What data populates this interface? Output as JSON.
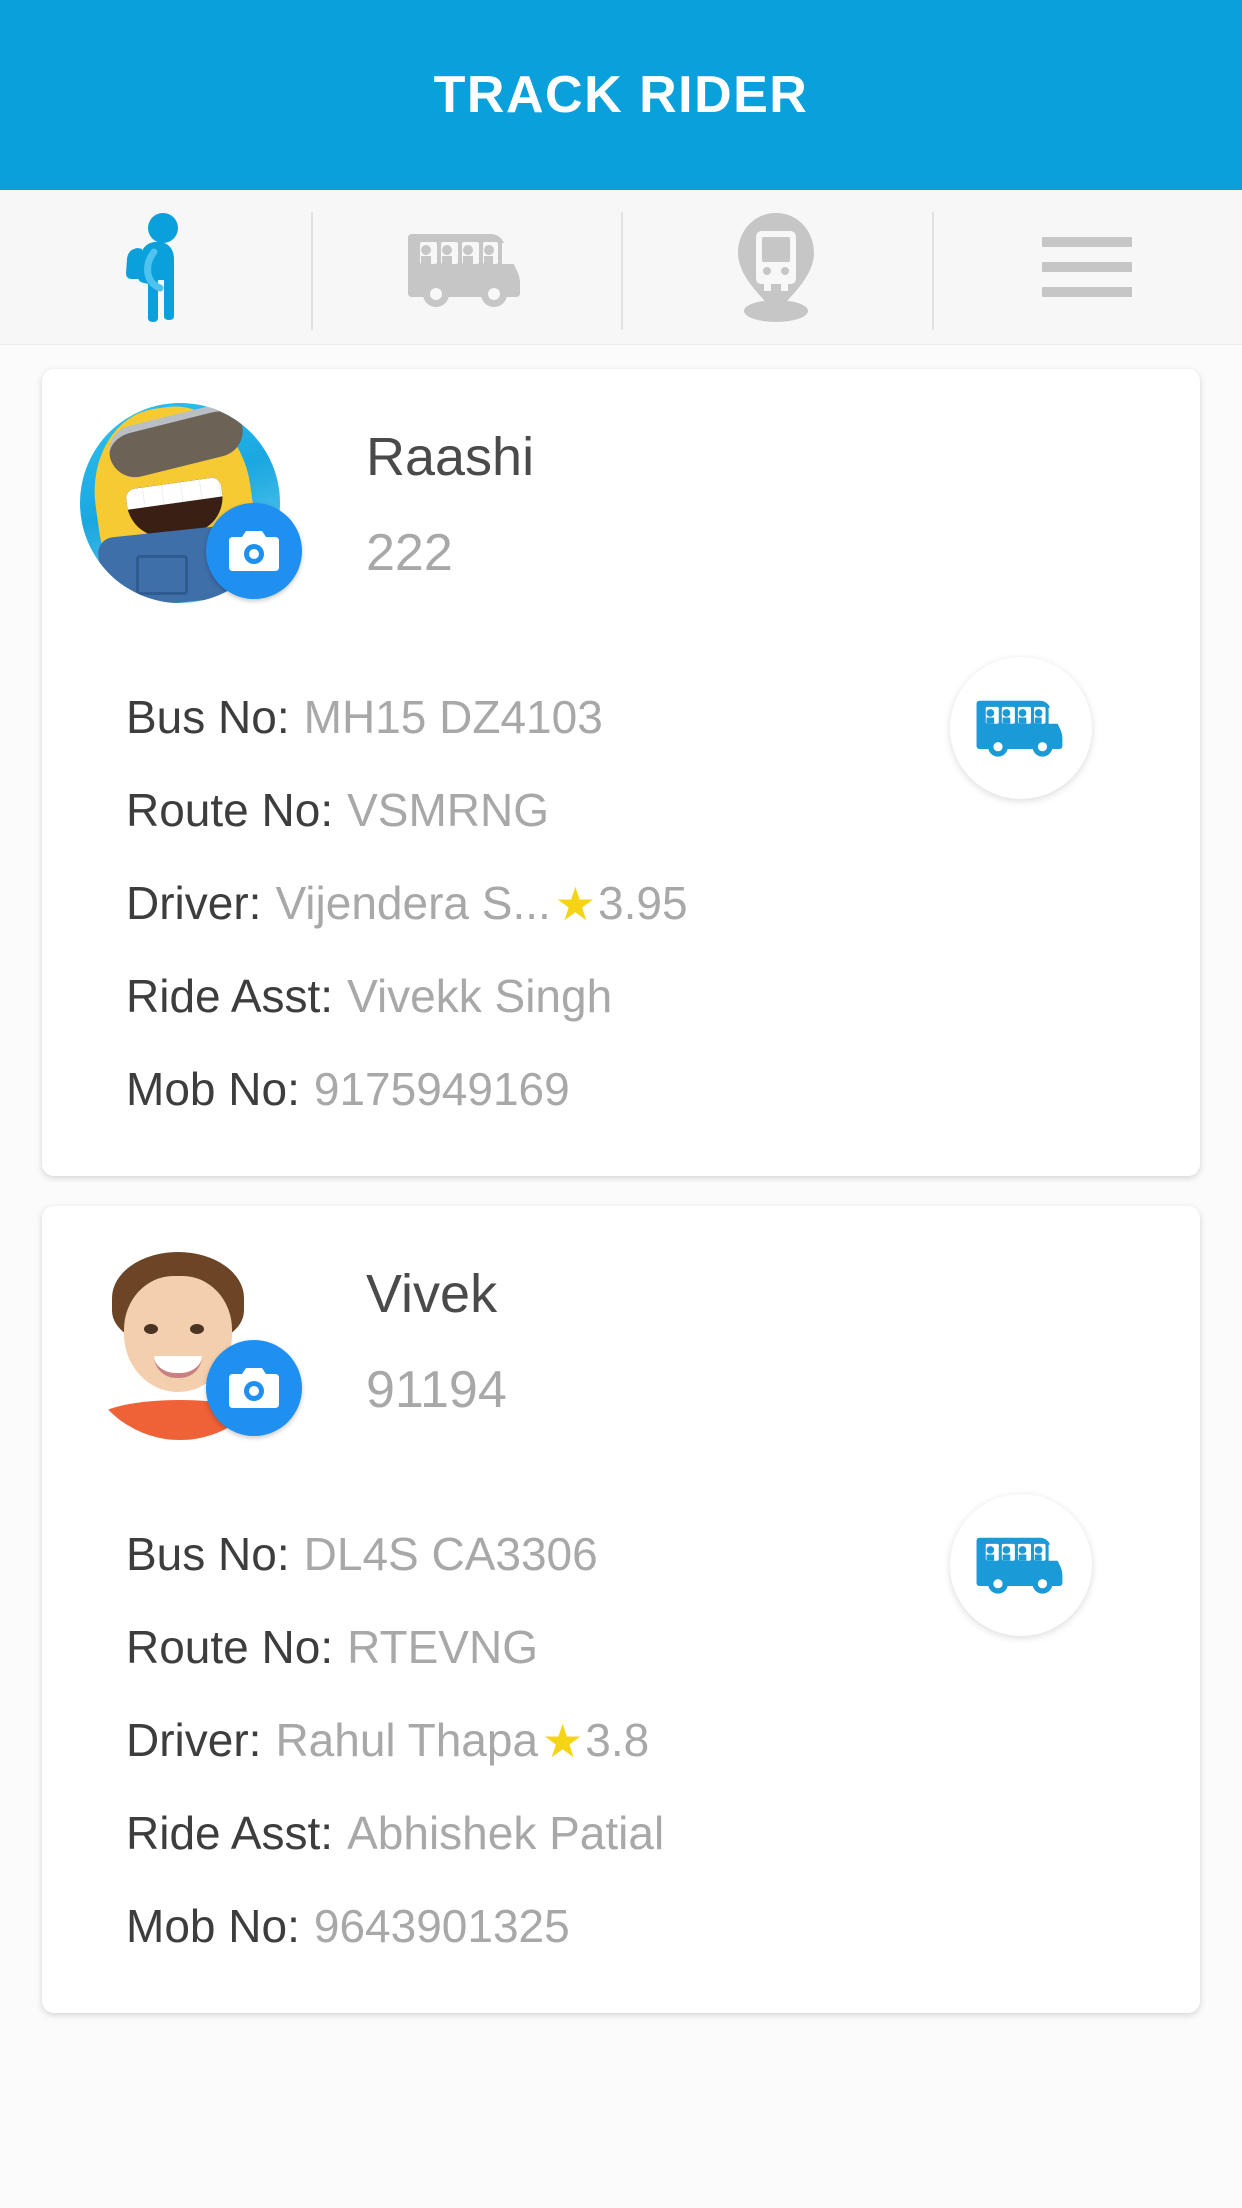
{
  "header": {
    "title": "TRACK RIDER",
    "background_color": "#09a0dc",
    "text_color": "#ffffff"
  },
  "tabbar": {
    "background_color": "#f7f7f7",
    "active_color": "#09a0dc",
    "inactive_color": "#c6c6c6",
    "tabs": [
      {
        "icon": "student-rider-icon",
        "name": "rider",
        "active": true
      },
      {
        "icon": "school-bus-icon",
        "name": "bus",
        "active": false
      },
      {
        "icon": "bus-location-pin-icon",
        "name": "track",
        "active": false
      },
      {
        "icon": "hamburger-menu-icon",
        "name": "menu",
        "active": false
      }
    ]
  },
  "labels": {
    "bus_no": "Bus No:",
    "route_no": "Route No:",
    "driver": "Driver:",
    "ride_asst": "Ride Asst:",
    "mob_no": "Mob No:"
  },
  "theme": {
    "accent_blue": "#1f8ff0",
    "bus_icon_blue": "#1b9ad8",
    "star_yellow": "#f5d416",
    "label_color": "#3d3d3d",
    "value_color": "#a8a8a8",
    "card_background": "#ffffff",
    "page_background": "#fbfbfb"
  },
  "riders": [
    {
      "name": "Raashi",
      "id": "222",
      "avatar": "minion-avatar",
      "camera_badge": "camera-icon",
      "bus_no": "MH15 DZ4103",
      "route_no": "VSMRNG",
      "driver": "Vijendera S...",
      "driver_rating": "3.95",
      "ride_asst": "Vivekk Singh",
      "mob_no": "9175949169",
      "bus_button": "school-bus-icon"
    },
    {
      "name": "Vivek",
      "id": "91194",
      "avatar": "boy-photo-avatar",
      "camera_badge": "camera-icon",
      "bus_no": "DL4S CA3306",
      "route_no": "RTEVNG",
      "driver": "Rahul Thapa",
      "driver_rating": "3.8",
      "ride_asst": "Abhishek Patial",
      "mob_no": "9643901325",
      "bus_button": "school-bus-icon"
    }
  ]
}
